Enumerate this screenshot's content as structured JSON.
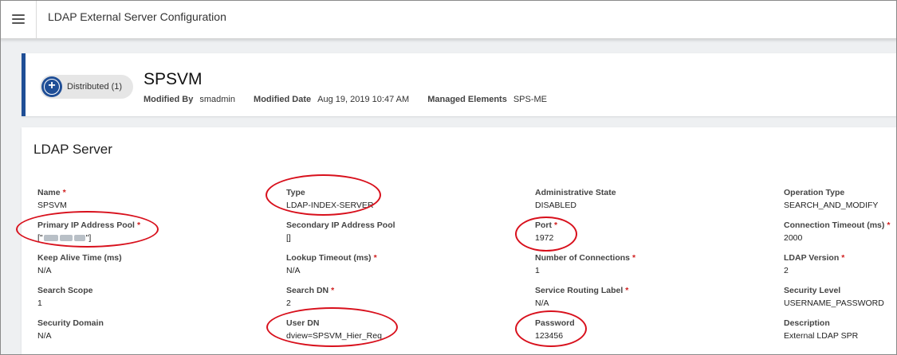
{
  "header": {
    "menu_icon": "hamburger-menu-icon",
    "title": "LDAP External Server Configuration"
  },
  "summary": {
    "distributed_label": "Distributed (1)",
    "name": "SPSVM",
    "modified_by_label": "Modified By",
    "modified_by": "smadmin",
    "modified_date_label": "Modified Date",
    "modified_date": "Aug 19, 2019 10:47 AM",
    "managed_elements_label": "Managed Elements",
    "managed_elements": "SPS-ME"
  },
  "ldap_server": {
    "title": "LDAP Server",
    "fields": [
      {
        "label": "Name",
        "value": "SPSVM",
        "required": true
      },
      {
        "label": "Type",
        "value": "LDAP-INDEX-SERVER",
        "required": false
      },
      {
        "label": "Administrative State",
        "value": "DISABLED",
        "required": false
      },
      {
        "label": "Operation Type",
        "value": "SEARCH_AND_MODIFY",
        "required": false
      },
      {
        "label": "Primary IP Address Pool",
        "value": "[\"",
        "value_suffix": "\"]",
        "required": true
      },
      {
        "label": "Secondary IP Address Pool",
        "value": "[]",
        "required": false
      },
      {
        "label": "Port",
        "value": "1972",
        "required": true
      },
      {
        "label": "Connection Timeout (ms)",
        "value": "2000",
        "required": true
      },
      {
        "label": "Keep Alive Time (ms)",
        "value": "N/A",
        "required": false
      },
      {
        "label": "Lookup Timeout (ms)",
        "value": "N/A",
        "required": true
      },
      {
        "label": "Number of Connections",
        "value": "1",
        "required": true
      },
      {
        "label": "LDAP Version",
        "value": "2",
        "required": true
      },
      {
        "label": "Search Scope",
        "value": "1",
        "required": false
      },
      {
        "label": "Search DN",
        "value": "2",
        "required": true
      },
      {
        "label": "Service Routing Label",
        "value": "N/A",
        "required": true
      },
      {
        "label": "Security Level",
        "value": "USERNAME_PASSWORD",
        "required": false
      },
      {
        "label": "Security Domain",
        "value": "N/A",
        "required": false
      },
      {
        "label": "User DN",
        "value": "dview=SPSVM_Hier_Req",
        "required": false
      },
      {
        "label": "Password",
        "value": "123456",
        "required": false
      },
      {
        "label": "Description",
        "value": "External LDAP SPR",
        "required": false
      }
    ]
  },
  "colors": {
    "accent": "#1f4e96",
    "required": "#d02020",
    "annotation": "#d8101c"
  }
}
